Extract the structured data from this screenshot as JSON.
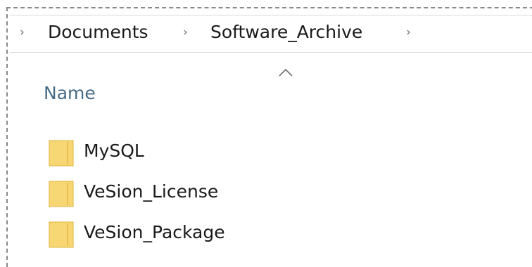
{
  "breadcrumb": {
    "items": [
      "Documents",
      "Software_Archive"
    ]
  },
  "columns": {
    "name_label": "Name"
  },
  "files": [
    {
      "name": "MySQL",
      "type": "folder"
    },
    {
      "name": "VeSion_License",
      "type": "folder"
    },
    {
      "name": "VeSion_Package",
      "type": "folder"
    }
  ],
  "icons": {
    "breadcrumb_separator": "chevron-right-icon",
    "sort": "chevron-up-icon",
    "folder": "folder-icon"
  },
  "colors": {
    "header_text": "#486c87",
    "folder_fill": "#f7d774",
    "folder_edge": "#e0b43c"
  }
}
